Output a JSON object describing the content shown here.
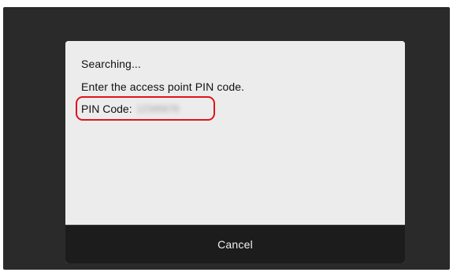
{
  "dialog": {
    "status_text": "Searching...",
    "instruction_text": "Enter the access point PIN code.",
    "pin_label": "PIN Code:",
    "pin_value": "12345678",
    "highlight_color": "#e0141e"
  },
  "footer": {
    "cancel_label": "Cancel"
  }
}
